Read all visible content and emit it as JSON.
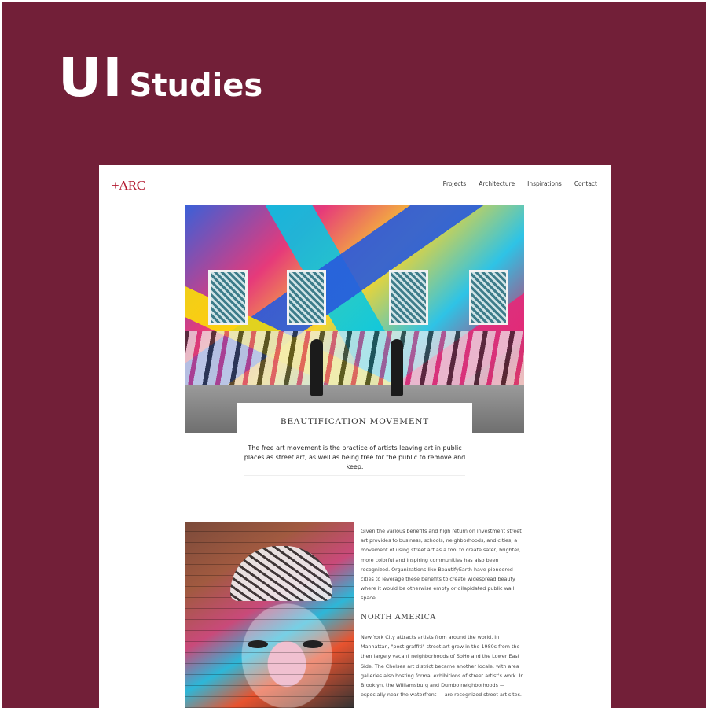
{
  "hero": {
    "title_big": "UI",
    "title_small": "Studies"
  },
  "site": {
    "logo": "+ARC",
    "nav": [
      {
        "label": "Projects"
      },
      {
        "label": "Architecture"
      },
      {
        "label": "Inspirations"
      },
      {
        "label": "Contact"
      }
    ]
  },
  "feature": {
    "title": "BEAUTIFICATION MOVEMENT",
    "text": "The free art movement is the practice of artists leaving art in public places as street art, as well as being free for the public to remove and keep."
  },
  "article": {
    "paragraph1": "Given the various benefits and high return on investment street art provides to business, schools, neighborhoods, and cities, a movement of using street art as a tool to create safer, brighter, more colorful and inspiring communities has also been recognized. Organizations like BeautifyEarth have pioneered cities to leverage these benefits to create widespread beauty where it would be otherwise empty or dilapidated public wall space.",
    "section_title": "NORTH AMERICA",
    "paragraph2": "New York City attracts artists from around the world. In Manhattan, \"post-graffiti\" street art grew in the 1980s from the then largely vacant neighborhoods of SoHo and the Lower East Side. The Chelsea art district became another locale, with area galleries also hosting formal exhibitions of street artist's work. In Brooklyn, the Williamsburg and Dumbo neighborhoods — especially near the waterfront — are recognized street art sites."
  },
  "colors": {
    "background": "#721f38",
    "logo_red": "#b3182f",
    "page": "#ffffff"
  }
}
